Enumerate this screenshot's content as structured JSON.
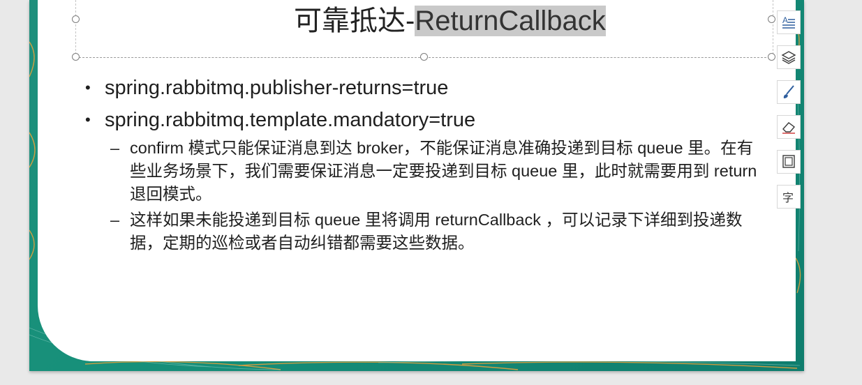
{
  "slide": {
    "title_prefix": "可靠抵达-",
    "title_selected": "ReturnCallback",
    "bullets": [
      {
        "text": "spring.rabbitmq.publisher-returns=true"
      },
      {
        "text": "spring.rabbitmq.template.mandatory=true"
      }
    ],
    "sub_bullets": [
      {
        "text": "confirm 模式只能保证消息到达 broker，不能保证消息准确投递到目标 queue 里。在有些业务场景下，我们需要保证消息一定要投递到目标 queue 里，此时就需要用到 return 退回模式。"
      },
      {
        "text": "这样如果未能投递到目标 queue 里将调用 returnCallback ，可以记录下详细到投递数据，定期的巡检或者自动纠错都需要这些数据。"
      }
    ],
    "bullet_char": "•",
    "dash_char": "–"
  },
  "toolbar": {
    "items": [
      {
        "icon": "text-format-icon",
        "glyph": "A"
      },
      {
        "icon": "layers-icon"
      },
      {
        "icon": "brush-icon"
      },
      {
        "icon": "eraser-icon"
      },
      {
        "icon": "frame-icon"
      },
      {
        "icon": "character-icon",
        "glyph": "字"
      }
    ]
  },
  "colors": {
    "slide_green": "#16907a",
    "accent_orange": "#f0a23a",
    "selection_gray": "#c9c9c9"
  }
}
